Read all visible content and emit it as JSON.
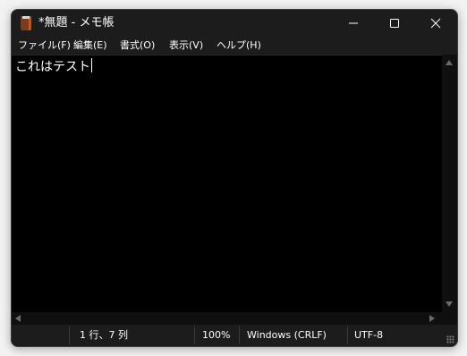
{
  "window": {
    "title": "*無題 - メモ帳"
  },
  "title_buttons": {
    "minimize": "minimize-icon",
    "maximize": "maximize-icon",
    "close": "close-icon"
  },
  "menu": {
    "items": [
      {
        "label": "ファイル(F)"
      },
      {
        "label": "編集(E)"
      },
      {
        "label": "書式(O)"
      },
      {
        "label": "表示(V)"
      },
      {
        "label": "ヘルプ(H)"
      }
    ]
  },
  "editor": {
    "content": "これはテスト"
  },
  "status": {
    "position": "1 行、7 列",
    "zoom": "100%",
    "line_ending": "Windows (CRLF)",
    "encoding": "UTF-8"
  },
  "colors": {
    "chrome": "#1c1c1c",
    "editor_background": "#000000",
    "text": "#ffffff",
    "app_icon": "#7a3b1f"
  }
}
